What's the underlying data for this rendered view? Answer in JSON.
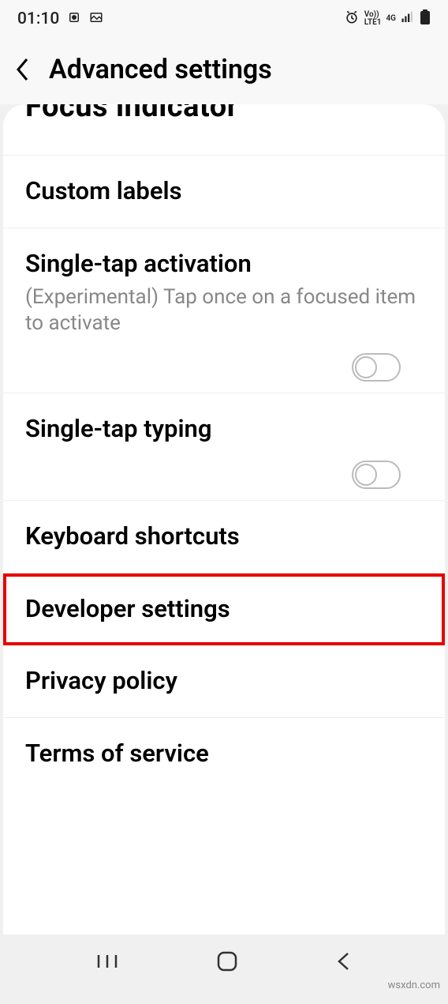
{
  "statusBar": {
    "time": "01:10",
    "networkLabel": "Vo))\nLTE1",
    "networkType": "4G"
  },
  "header": {
    "title": "Advanced settings"
  },
  "items": {
    "focusIndicator": "Focus indicator",
    "customLabels": "Custom labels",
    "singleTapActivation": {
      "title": "Single-tap activation",
      "subtitle": "(Experimental) Tap once on a focused item to activate"
    },
    "singleTapTyping": "Single-tap typing",
    "keyboardShortcuts": "Keyboard shortcuts",
    "developerSettings": "Developer settings",
    "privacyPolicy": "Privacy policy",
    "termsOfService": "Terms of service"
  },
  "watermark": "wsxdn.com"
}
